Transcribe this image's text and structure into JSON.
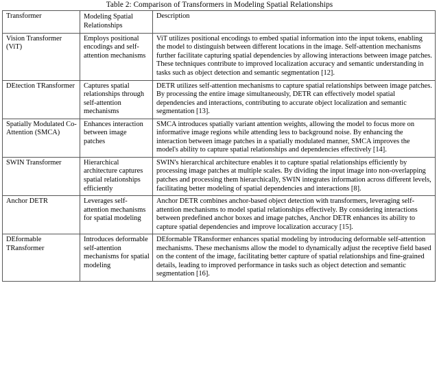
{
  "caption": "Table 2: Comparison of Transformers in Modeling Spatial Relationships",
  "table": {
    "headers": {
      "transformer": "Transformer",
      "modeling": "Modeling Spatial Relationships",
      "description": "Description"
    },
    "rows": [
      {
        "transformer": "Vision Transformer (ViT)",
        "modeling": "Employs positional encodings and self-attention mechanisms",
        "description": "ViT utilizes positional encodings to embed spatial information into the input tokens, enabling the model to distinguish between different locations in the image. Self-attention mechanisms further facilitate capturing spatial dependencies by allowing interactions between image patches. These techniques contribute to improved localization accuracy and semantic understanding in tasks such as object detection and semantic segmentation [12]."
      },
      {
        "transformer": "DEtection TRansformer",
        "modeling": "Captures spatial relationships through self-attention mechanisms",
        "description": "DETR utilizes self-attention mechanisms to capture spatial relationships between image patches. By processing the entire image simultaneously, DETR can effectively model spatial dependencies and interactions, contributing to accurate object localization and semantic segmentation [13]."
      },
      {
        "transformer": "Spatially Modulated Co-Attention (SMCA)",
        "modeling": "Enhances interaction between image patches",
        "description": "SMCA introduces spatially variant attention weights, allowing the model to focus more on informative image regions while attending less to background noise. By enhancing the interaction between image patches in a spatially modulated manner, SMCA improves the model's ability to capture spatial relationships and dependencies effectively [14]."
      },
      {
        "transformer": "SWIN Transformer",
        "modeling": "Hierarchical architecture captures spatial relationships efficiently",
        "description": "SWIN's hierarchical architecture enables it to capture spatial relationships efficiently by processing image patches at multiple scales. By dividing the input image into non-overlapping patches and processing them hierarchically, SWIN integrates information across different levels, facilitating better modeling of spatial dependencies and interactions [8]."
      },
      {
        "transformer": "Anchor DETR",
        "modeling": "Leverages self-attention mechanisms for spatial modeling",
        "description": "Anchor DETR combines anchor-based object detection with transformers, leveraging self-attention mechanisms to model spatial relationships effectively. By considering interactions between predefined anchor boxes and image patches, Anchor DETR enhances its ability to capture spatial dependencies and improve localization accuracy [15]."
      },
      {
        "transformer": "DEformable TRansformer",
        "modeling": "Introduces deformable self-attention mechanisms for spatial modeling",
        "description": "DEformable TRansformer enhances spatial modeling by introducing deformable self-attention mechanisms. These mechanisms allow the model to dynamically adjust the receptive field based on the content of the image, facilitating better capture of spatial relationships and fine-grained details, leading to improved performance in tasks such as object detection and semantic segmentation [16]."
      }
    ]
  }
}
